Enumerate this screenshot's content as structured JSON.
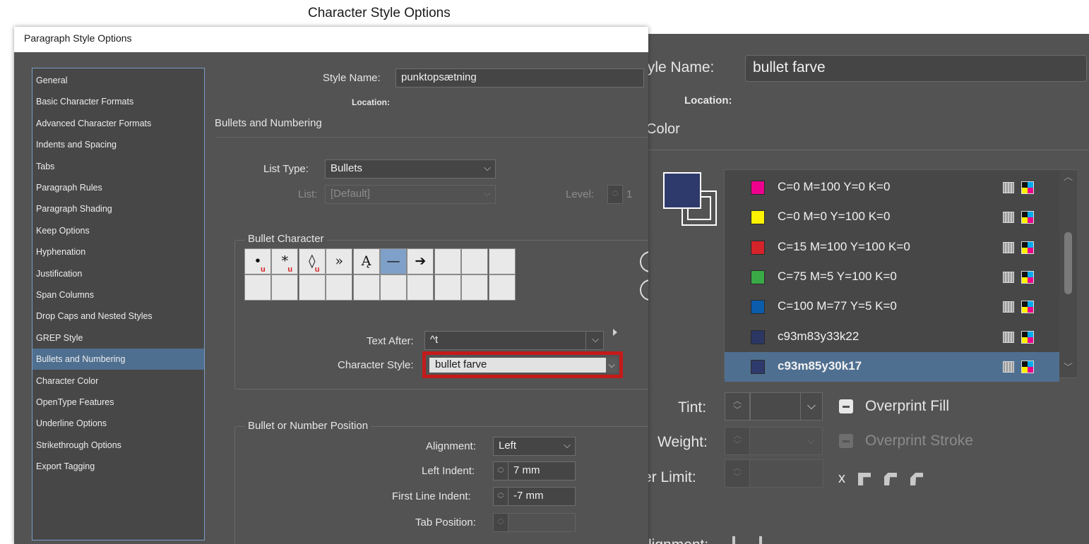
{
  "char_dialog": {
    "title": "Character Style Options",
    "style_name_label": "Style Name:",
    "style_name_value": "bullet farve",
    "location_label": "Location:",
    "section_title": "Color",
    "swatches": [
      {
        "name": "C=0 M=100 Y=0 K=0",
        "color": "#ec008c"
      },
      {
        "name": "C=0 M=0 Y=100 K=0",
        "color": "#fff200"
      },
      {
        "name": "C=15 M=100 Y=100 K=0",
        "color": "#d5232a"
      },
      {
        "name": "C=75 M=5 Y=100 K=0",
        "color": "#3aaa48"
      },
      {
        "name": "C=100 M=77 Y=5 K=0",
        "color": "#0b5cab"
      },
      {
        "name": "c93m83y33k22",
        "color": "#2b3663"
      },
      {
        "name": "c93m85y30k17",
        "color": "#2e3a6b",
        "selected": true
      }
    ],
    "tint_label": "Tint:",
    "overprint_fill_label": "Overprint Fill",
    "weight_label": "Weight:",
    "overprint_stroke_label": "Overprint Stroke",
    "miter_limit_label": "Miter Limit:",
    "miter_x": "x",
    "alignment_label": "Alignment:"
  },
  "para_dialog": {
    "title": "Paragraph Style Options",
    "categories": [
      "General",
      "Basic Character Formats",
      "Advanced Character Formats",
      "Indents and Spacing",
      "Tabs",
      "Paragraph Rules",
      "Paragraph Shading",
      "Keep Options",
      "Hyphenation",
      "Justification",
      "Span Columns",
      "Drop Caps and Nested Styles",
      "GREP Style",
      "Bullets and Numbering",
      "Character Color",
      "OpenType Features",
      "Underline Options",
      "Strikethrough Options",
      "Export Tagging"
    ],
    "selected_category": "Bullets and Numbering",
    "style_name_label": "Style Name:",
    "style_name_value": "punktopsætning",
    "location_label": "Location:",
    "section_title": "Bullets and Numbering",
    "list_type_label": "List Type:",
    "list_type_value": "Bullets",
    "list_label": "List:",
    "list_value": "[Default]",
    "level_label": "Level:",
    "level_value": "1",
    "bullet_character_title": "Bullet Character",
    "bullets": [
      {
        "glyph": "•",
        "u": true
      },
      {
        "glyph": "*",
        "u": true
      },
      {
        "glyph": "◊",
        "u": true
      },
      {
        "glyph": "»",
        "u": false
      },
      {
        "glyph": "Ą",
        "u": false
      },
      {
        "glyph": "—",
        "u": false,
        "selected": true
      },
      {
        "glyph": "➔",
        "u": false
      }
    ],
    "text_after_label": "Text After:",
    "text_after_value": "^t",
    "character_style_label": "Character Style:",
    "character_style_value": "bullet farve",
    "position_title": "Bullet or Number Position",
    "alignment_label": "Alignment:",
    "alignment_value": "Left",
    "left_indent_label": "Left Indent:",
    "left_indent_value": "7 mm",
    "first_line_indent_label": "First Line Indent:",
    "first_line_indent_value": "-7 mm",
    "tab_position_label": "Tab Position:",
    "tab_position_value": ""
  },
  "colors": {
    "dialog_bg": "#535353",
    "selection": "#4f6f90",
    "highlight_box": "#c41a1a"
  }
}
